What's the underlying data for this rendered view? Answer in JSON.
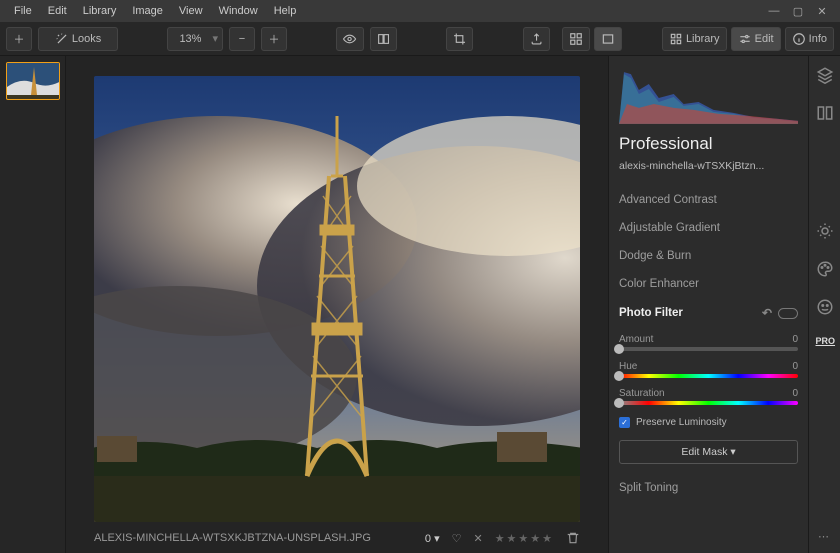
{
  "menu": {
    "file": "File",
    "edit": "Edit",
    "library": "Library",
    "image": "Image",
    "view": "View",
    "window": "Window",
    "help": "Help"
  },
  "toolbar": {
    "looks": "Looks",
    "zoom": "13%",
    "library": "Library",
    "edit": "Edit",
    "info": "Info"
  },
  "panel": {
    "preset": "Professional",
    "filename": "alexis-minchella-wTSXKjBtzn...",
    "tools": {
      "ac": "Advanced Contrast",
      "ag": "Adjustable Gradient",
      "db": "Dodge & Burn",
      "ce": "Color Enhancer",
      "pf": "Photo Filter",
      "st": "Split Toning"
    },
    "sliders": {
      "amount_l": "Amount",
      "amount_v": "0",
      "hue_l": "Hue",
      "hue_v": "0",
      "sat_l": "Saturation",
      "sat_v": "0"
    },
    "preserve": "Preserve Luminosity",
    "editmask": "Edit Mask ▾"
  },
  "status": {
    "file": "ALEXIS-MINCHELLA-WTSXKJBTZNA-UNSPLASH.JPG",
    "rating_zero": "0 ▾",
    "heart": "♡",
    "x": "✕",
    "stars": "★★★★★"
  },
  "sidebar": {
    "pro": "PRO"
  }
}
